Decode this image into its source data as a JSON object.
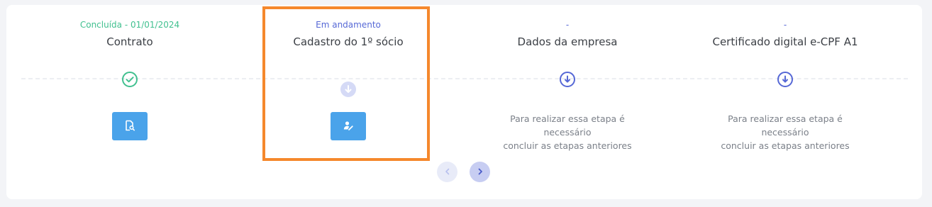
{
  "steps": [
    {
      "status": "Concluída - 01/01/2024",
      "title": "Contrato",
      "state": "completed",
      "indicator_icon": "check-circle-icon",
      "action_icon": "document-search-icon"
    },
    {
      "status": "Em andamento",
      "title": "Cadastro do 1º sócio",
      "state": "in-progress",
      "indicator_icon": "arrow-down-circle-icon",
      "action_icon": "user-edit-icon"
    },
    {
      "status": "-",
      "title": "Dados da empresa",
      "state": "pending",
      "indicator_icon": "arrow-down-circle-icon",
      "note_line1": "Para realizar essa etapa é necessário",
      "note_line2": "concluir as etapas anteriores"
    },
    {
      "status": "-",
      "title": "Certificado digital e-CPF A1",
      "state": "pending",
      "indicator_icon": "arrow-down-circle-icon",
      "note_line1": "Para realizar essa etapa é necessário",
      "note_line2": "concluir as etapas anteriores"
    }
  ],
  "pagination": {
    "prev_icon": "chevron-left-icon",
    "next_icon": "chevron-right-icon"
  },
  "colors": {
    "completed": "#41c08f",
    "in_progress": "#5668d6",
    "pending_indicator": "#5668d6",
    "action_button": "#4aa3ea",
    "highlight": "#f5882c"
  }
}
